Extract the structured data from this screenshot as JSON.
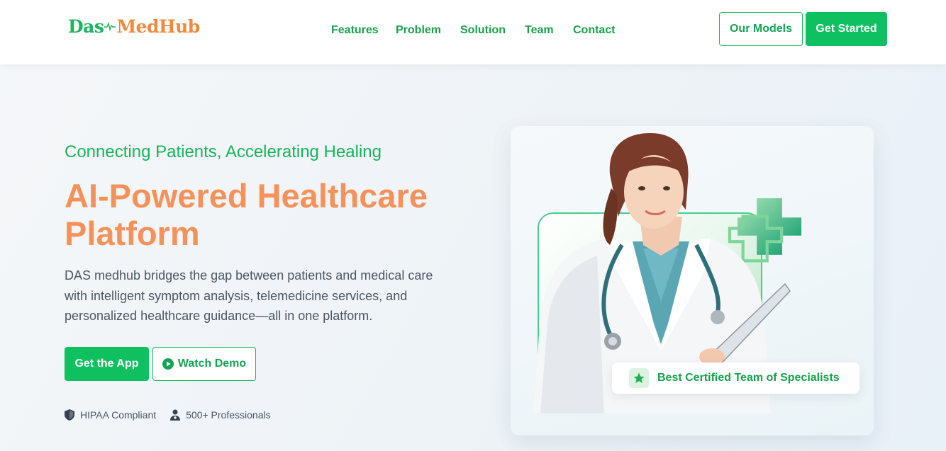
{
  "brand": {
    "logo_part1": "Das",
    "logo_part2": "MedHub",
    "colors": {
      "primary_green": "#0ec05f",
      "accent_orange": "#f5925a"
    }
  },
  "nav": {
    "items": [
      {
        "label": "Features"
      },
      {
        "label": "Problem"
      },
      {
        "label": "Solution"
      },
      {
        "label": "Team"
      },
      {
        "label": "Contact"
      }
    ],
    "our_models_label": "Our Models",
    "get_started_label": "Get Started"
  },
  "hero": {
    "tagline": "Connecting Patients, Accelerating Healing",
    "headline": "AI-Powered Healthcare Platform",
    "description": "DAS medhub bridges the gap between patients and medical care with intelligent symptom analysis, telemedicine services, and personalized healthcare guidance—all in one platform.",
    "get_app_label": "Get the App",
    "watch_demo_label": "Watch Demo",
    "badges": [
      {
        "icon": "shield-icon",
        "label": "HIPAA Compliant"
      },
      {
        "icon": "doctor-icon",
        "label": "500+ Professionals"
      }
    ]
  },
  "showcase": {
    "image": "doctor-with-stethoscope-and-clipboard",
    "badge_icon": "star-icon",
    "badge_text": "Best Certified Team of Specialists"
  }
}
